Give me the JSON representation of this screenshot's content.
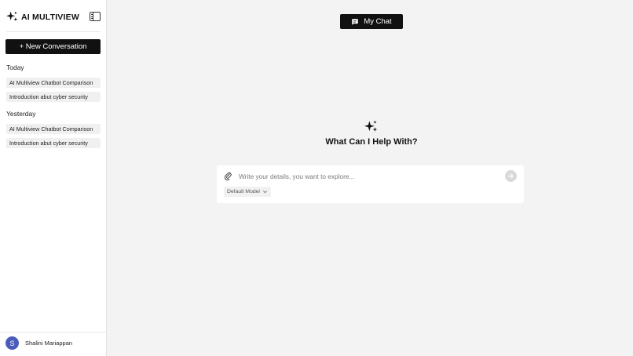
{
  "brand": {
    "name": "AI MULTIVIEW",
    "icon": "sparkle-icon"
  },
  "sidebar": {
    "new_conversation_label": "+ New Conversation",
    "sections": [
      {
        "label": "Today",
        "items": [
          "AI Multiview Chatbot Comparison",
          "Introduction abut cyber security"
        ]
      },
      {
        "label": "Yesterday",
        "items": [
          "AI Multiview Chatbot Comparison",
          "Introduction abut cyber security"
        ]
      }
    ],
    "user": {
      "initial": "S",
      "name": "Shalini Mariappan",
      "avatar_color": "#4a5cbb"
    }
  },
  "header": {
    "my_chat_label": "My Chat",
    "icon": "chat-bubble-icon"
  },
  "main": {
    "title": "What Can I Help With?",
    "composer": {
      "placeholder": "Write your details, you want to explore...",
      "value": "",
      "model_label": "Default Model",
      "attach_icon": "attach-icon",
      "send_icon": "send-icon"
    }
  }
}
